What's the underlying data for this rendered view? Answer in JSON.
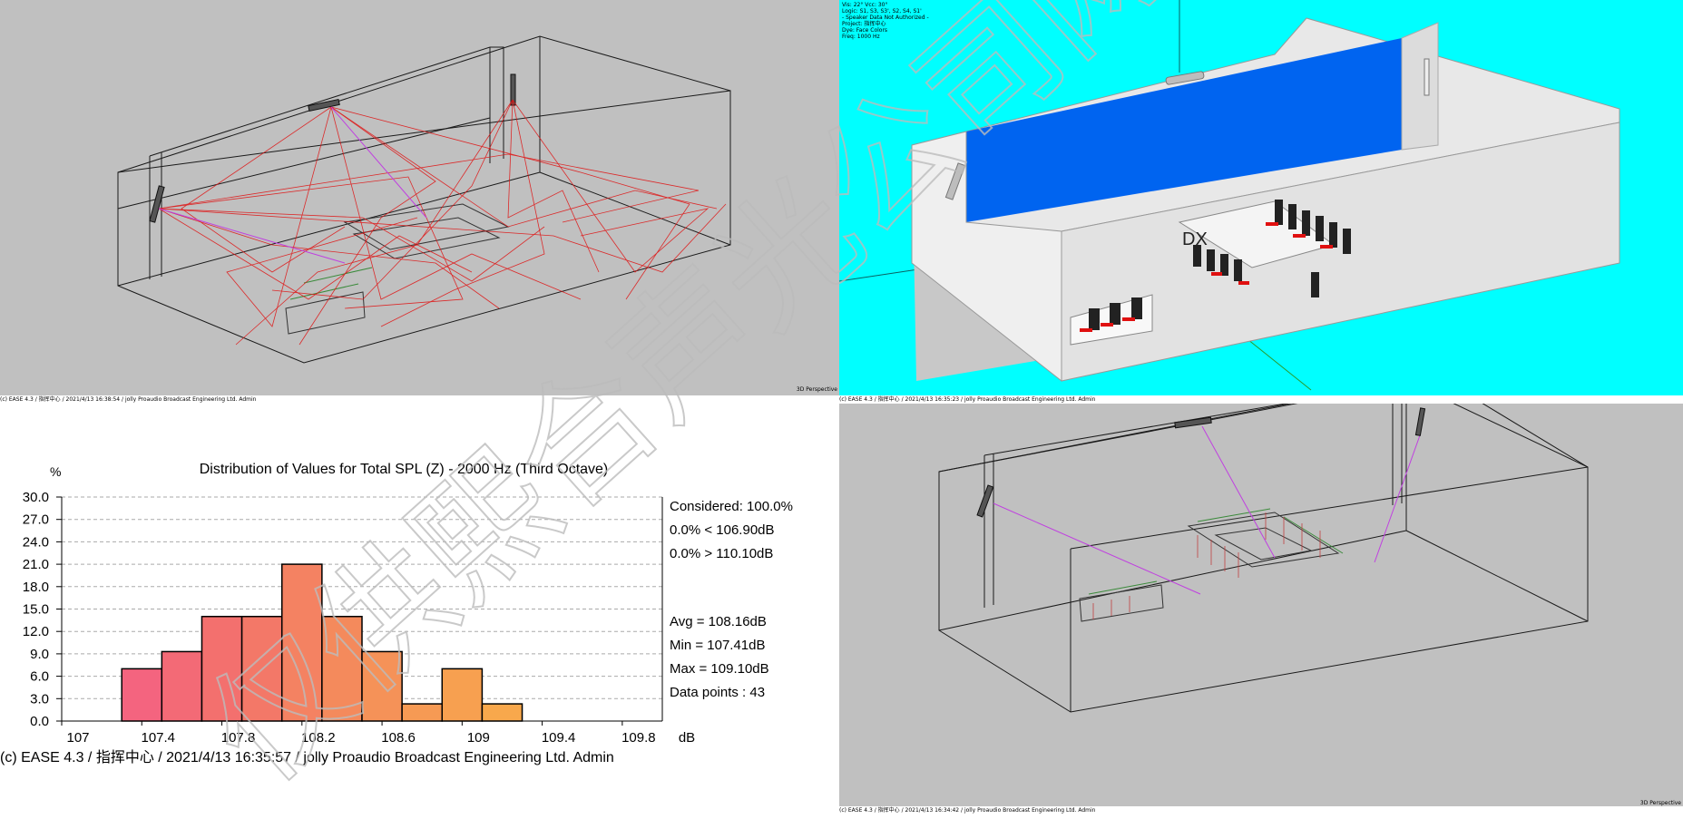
{
  "views": {
    "top_left": {
      "status": "(c) EASE 4.3 / 指挥中心 / 2021/4/13 16:38:54 / jolly Proaudio Broadcast Engineering Ltd. Admin",
      "corner": "3D Perspective"
    },
    "top_right": {
      "status": "(c) EASE 4.3 / 指挥中心 / 2021/4/13 16:35:23 / jolly Proaudio Broadcast Engineering Ltd. Admin",
      "info": [
        "Vis: 22°  Vcc: 30°",
        "Logic: S1, S3, S3', S2, S4, S1'",
        "- Speaker Data Not Authorized -",
        "Project: 指挥中心",
        "Dye: Face Colors",
        "Freq: 1000 Hz"
      ],
      "room_label": "DX"
    },
    "bottom_right": {
      "status": "(c) EASE 4.3 / 指挥中心 / 2021/4/13 16:34:42 / jolly Proaudio Broadcast Engineering Ltd. Admin",
      "corner": "3D Perspective"
    },
    "histogram": {
      "footer": "(c) EASE 4.3 / 指挥中心  / 2021/4/13 16:35:57 / jolly Proaudio Broadcast Engineering Ltd. Admin",
      "stats_top": [
        "Considered: 100.0%",
        "0.0% < 106.90dB",
        "0.0% > 110.10dB"
      ],
      "stats_bottom": [
        "Avg = 108.16dB",
        "Min = 107.41dB",
        "Max = 109.10dB",
        "Data points : 43"
      ]
    }
  },
  "watermark": "仅供熙合声光公司网站使用",
  "colors": {
    "cyan_bg": "#00ffff",
    "gray_bg": "#c0c0c0",
    "blue_wall": "#0064f0",
    "ray": "#e01010",
    "ray_direct": "#c040e0"
  },
  "chart_data": {
    "type": "bar",
    "title": "Distribution of Values for Total SPL (Z)  - 2000 Hz (Third Octave)",
    "ylabel": "%",
    "xlabel": "dB",
    "ylim": [
      0,
      30
    ],
    "yticks": [
      "30.0",
      "27.0",
      "24.0",
      "21.0",
      "18.0",
      "15.0",
      "12.0",
      "9.0",
      "6.0",
      "3.0",
      "0.0"
    ],
    "xlim": [
      107,
      110
    ],
    "xticks": [
      "107",
      "107.4",
      "107.8",
      "108.2",
      "108.6",
      "109",
      "109.4",
      "109.8"
    ],
    "bin_width": 0.2,
    "bins": [
      {
        "x": 107.4,
        "value": 7.0,
        "color": "#f4647f"
      },
      {
        "x": 107.6,
        "value": 9.3,
        "color": "#f36a76"
      },
      {
        "x": 107.8,
        "value": 14.0,
        "color": "#f3706e"
      },
      {
        "x": 108.0,
        "value": 14.0,
        "color": "#f37868"
      },
      {
        "x": 108.2,
        "value": 21.0,
        "color": "#f48262"
      },
      {
        "x": 108.4,
        "value": 14.0,
        "color": "#f48a5c"
      },
      {
        "x": 108.6,
        "value": 9.3,
        "color": "#f59258"
      },
      {
        "x": 108.8,
        "value": 2.3,
        "color": "#f69a54"
      },
      {
        "x": 109.0,
        "value": 7.0,
        "color": "#f7a050"
      },
      {
        "x": 109.2,
        "value": 2.3,
        "color": "#f8a84c"
      }
    ]
  }
}
